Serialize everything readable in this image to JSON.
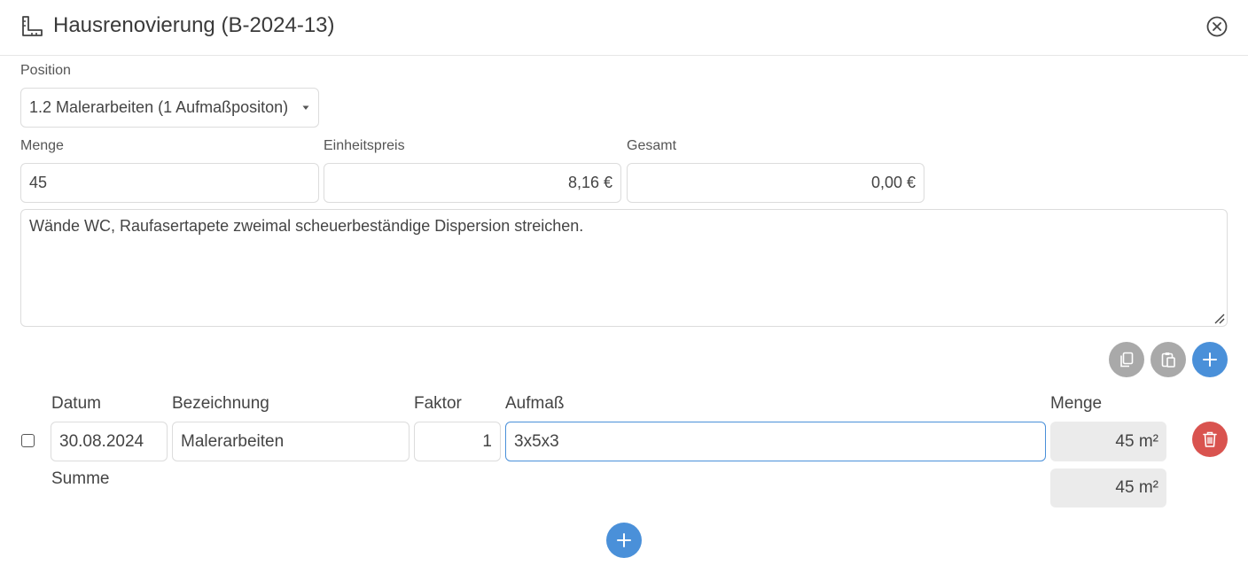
{
  "header": {
    "title": "Hausrenovierung (B-2024-13)",
    "icon": "ruler-square-icon",
    "close_icon": "close-circle-icon"
  },
  "position": {
    "label": "Position",
    "value": "1.2 Malerarbeiten (1 Aufmaßpositon)"
  },
  "menge": {
    "label": "Menge",
    "value": "45"
  },
  "einheitspreis": {
    "label": "Einheitspreis",
    "value": "8,16 €"
  },
  "gesamt": {
    "label": "Gesamt",
    "value": "0,00 €"
  },
  "description": "Wände WC, Raufasertapete zweimal scheuerbeständige Dispersion streichen.",
  "toolbar": {
    "copy_icon": "copy-icon",
    "paste_icon": "paste-icon",
    "add_icon": "plus-icon"
  },
  "table": {
    "headers": {
      "datum": "Datum",
      "bezeichnung": "Bezeichnung",
      "faktor": "Faktor",
      "aufmass": "Aufmaß",
      "menge": "Menge"
    },
    "rows": [
      {
        "datum": "30.08.2024",
        "bezeichnung": "Malerarbeiten",
        "faktor": "1",
        "aufmass": "3x5x3",
        "menge": "45 m²"
      }
    ],
    "summe_label": "Summe",
    "summe_value": "45 m²"
  },
  "colors": {
    "accent": "#4a90d9",
    "danger": "#d9534f",
    "neutral_button": "#a9a9a9"
  }
}
